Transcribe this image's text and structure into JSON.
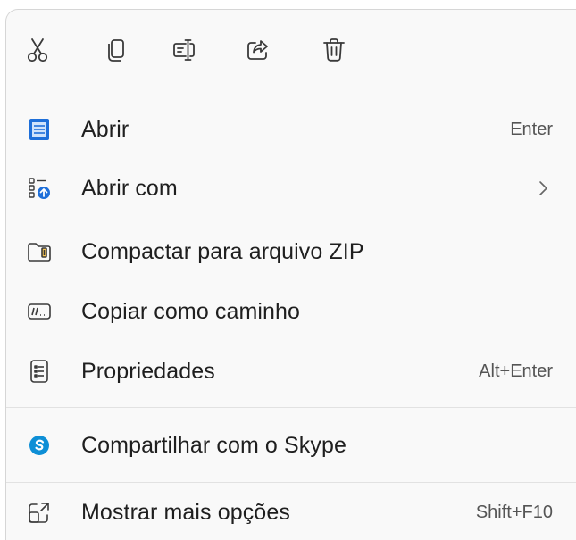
{
  "toolbar": {
    "buttons": [
      {
        "icon": "cut-icon"
      },
      {
        "icon": "copy-icon"
      },
      {
        "icon": "rename-icon"
      },
      {
        "icon": "share-icon"
      },
      {
        "icon": "delete-icon"
      }
    ]
  },
  "items": [
    {
      "label": "Abrir",
      "shortcut": "Enter",
      "icon": "notepad-icon"
    },
    {
      "label": "Abrir com",
      "shortcut": "",
      "icon": "open-with-icon",
      "submenu": true
    },
    {
      "label": "Compactar para arquivo ZIP",
      "shortcut": "",
      "icon": "zip-folder-icon"
    },
    {
      "label": "Copiar como caminho",
      "shortcut": "",
      "icon": "copy-path-icon"
    },
    {
      "label": "Propriedades",
      "shortcut": "Alt+Enter",
      "icon": "properties-icon"
    },
    {
      "label": "Compartilhar com o Skype",
      "shortcut": "",
      "icon": "skype-icon"
    },
    {
      "label": "Mostrar mais opções",
      "shortcut": "Shift+F10",
      "icon": "more-options-icon"
    }
  ],
  "colors": {
    "menu_background": "#f9f9f9",
    "text": "#1f1f1f",
    "shortcut_text": "#555555",
    "icon_blue": "#1e6fd9",
    "skype_blue": "#0e8fd6"
  }
}
